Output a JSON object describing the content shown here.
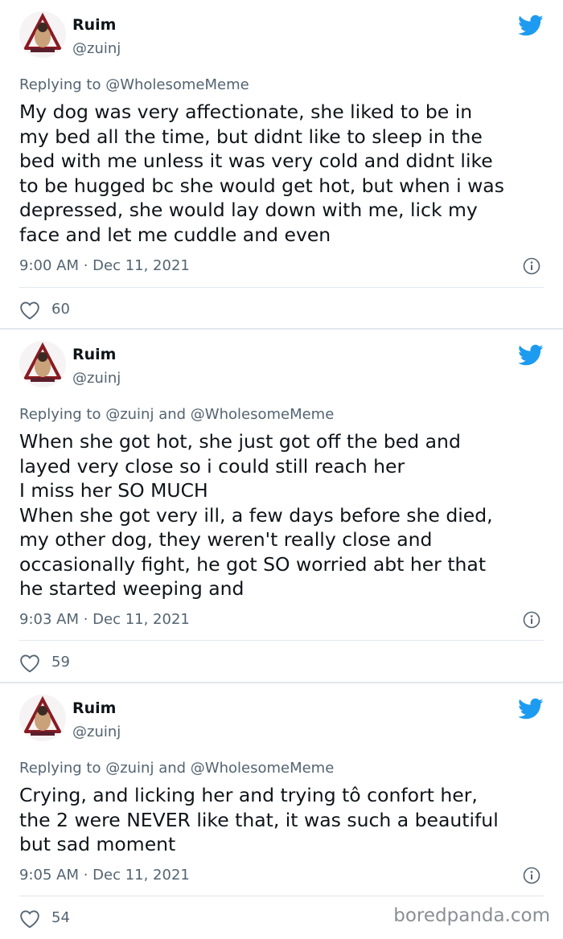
{
  "tweets": [
    {
      "name": "Ruim",
      "handle": "@zuinj",
      "replying": "Replying to @WholesomeMeme",
      "text": "My dog was very affectionate, she liked to be in\nmy bed all the time, but didnt like to sleep in the\nbed with me unless it was very cold and didnt like\nto be hugged bc she would get hot, but when i was\ndepressed, she would lay down with me, lick my\nface and let me cuddle and even",
      "timestamp": "9:00 AM · Dec 11, 2021",
      "likes": "60"
    },
    {
      "name": "Ruim",
      "handle": "@zuinj",
      "replying": "Replying to @zuinj and @WholesomeMeme",
      "text": "When she got hot, she just got off the bed and\nlayed very close so i could still reach her\nI miss her SO MUCH\nWhen she got very ill, a few days before she died,\nmy other dog, they weren't really close and\noccasionally fight, he got SO worried abt her that\nhe started weeping and",
      "timestamp": "9:03 AM · Dec 11, 2021",
      "likes": "59"
    },
    {
      "name": "Ruim",
      "handle": "@zuinj",
      "replying": "Replying to @zuinj and @WholesomeMeme",
      "text": "Crying, and licking her and trying tô confort her,\nthe 2 were NEVER like that, it was such a beautiful\nbut sad moment",
      "timestamp": "9:05 AM · Dec 11, 2021",
      "likes": "54"
    }
  ],
  "watermark": "boredpanda.com",
  "colors": {
    "twitter_blue": "#1d9bf0",
    "muted": "#536471",
    "divider": "#e1e8ed"
  },
  "icons": [
    "avatar",
    "twitter-bird-icon",
    "info-icon",
    "heart-icon"
  ]
}
